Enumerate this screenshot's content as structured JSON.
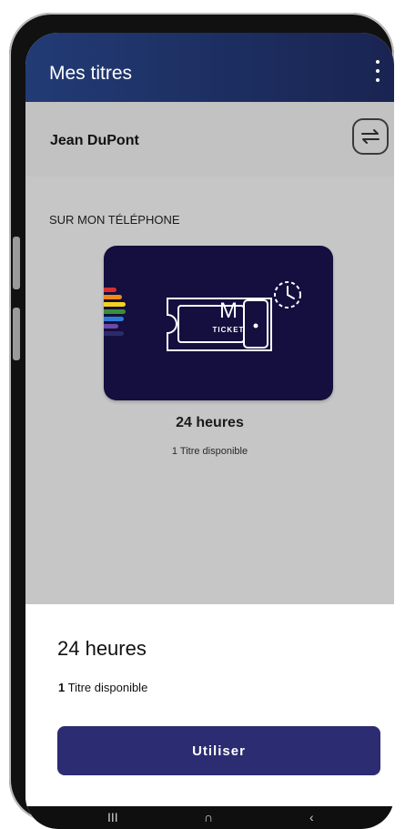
{
  "appbar": {
    "title": "Mes titres",
    "menu_icon": "more-vertical-icon"
  },
  "user": {
    "name": "Jean DuPont",
    "switch_icon": "swap-arrows-icon"
  },
  "section": {
    "label": "SUR MON TÉLÉPHONE"
  },
  "ticket": {
    "logo_letter": "M",
    "logo_text": "TICKET",
    "title": "24 heures",
    "subtitle": "1 Titre disponible",
    "card_color": "#140f3e",
    "stripe_colors": [
      "#d72f2f",
      "#f08a1a",
      "#f3d21c",
      "#3a8f3a",
      "#2e7bd7",
      "#6b4aa6",
      "#2b2b6b"
    ]
  },
  "sheet": {
    "title": "24 heures",
    "count": "1",
    "count_label": "Titre disponible",
    "button_label": "Utiliser",
    "button_color": "#2c2c72"
  },
  "system_nav": {
    "recent": "III",
    "home": "∩",
    "back": "‹"
  }
}
